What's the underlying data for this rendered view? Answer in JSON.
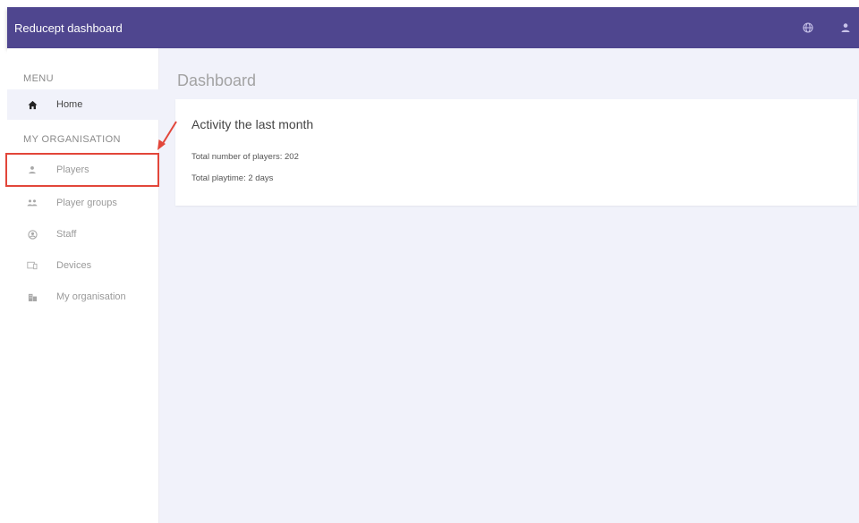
{
  "header": {
    "title": "Reducept dashboard",
    "language_icon": "globe-icon",
    "account_icon": "user-icon",
    "background_color": "#4f468f"
  },
  "sidebar": {
    "menu_label": "MENU",
    "home": {
      "label": "Home",
      "icon": "home-icon"
    },
    "organisation_label": "MY ORGANISATION",
    "items": [
      {
        "label": "Players",
        "icon": "person-icon"
      },
      {
        "label": "Player groups",
        "icon": "group-icon"
      },
      {
        "label": "Staff",
        "icon": "account-circle-icon"
      },
      {
        "label": "Devices",
        "icon": "devices-icon"
      },
      {
        "label": "My organisation",
        "icon": "building-icon"
      }
    ]
  },
  "main": {
    "page_title": "Dashboard",
    "card": {
      "title": "Activity the last month",
      "total_players": "Total number of players: 202",
      "total_playtime": "Total playtime: 2 days"
    }
  },
  "annotation": {
    "highlight_color": "#e2463a",
    "highlighted_item": "Players"
  }
}
